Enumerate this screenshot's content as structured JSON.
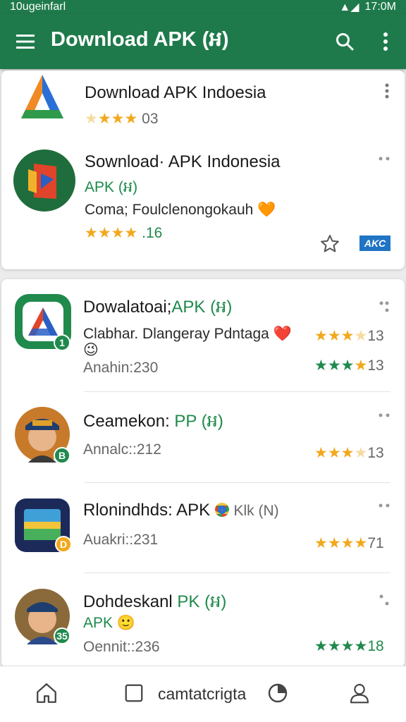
{
  "status_bar": {
    "left_text": "10ugeinfarl",
    "time": "17:0M"
  },
  "app_bar": {
    "title": "Download APK (អ)"
  },
  "featured": [
    {
      "title": "Download APK Indoesia",
      "rating_text": "03",
      "stars": 4
    },
    {
      "title": "Sownload· APK Indonesia",
      "tag": "APK (អ)",
      "description": "Coma; Foulclenongokauh 🧡",
      "rating_text": ".16",
      "stars": 4,
      "badge": "AKC"
    }
  ],
  "list": [
    {
      "title_prefix": "Dowalatoai;",
      "title_suffix": "APK (អ)",
      "description": "Clabhar. Dlangeray Pdntaga ❤️",
      "emoji": "😉",
      "meta": "Anahin:230",
      "rating1": "13",
      "rating2": "13",
      "badge": "1"
    },
    {
      "title_prefix": "Ceamekon:",
      "title_suffix": "PP (អ)",
      "meta": "Annalc::212",
      "rating1": "13",
      "badge": "B"
    },
    {
      "title_prefix": "Rlonindhds: APK",
      "title_suffix": "Klk (N)",
      "meta": "Auakri::231",
      "rating1": "71",
      "badge": "D"
    },
    {
      "title_prefix": "Dohdeskanl",
      "title_suffix": "PK (អ)",
      "tag": "APK 🙂",
      "meta": "Oennit::236",
      "rating1": "18",
      "badge": "35"
    }
  ],
  "bottom_nav": {
    "label": "camtatcrigta"
  },
  "colors": {
    "primary": "#1f7a4b",
    "accent_green": "#1f8a4c",
    "star": "#f2a81d"
  }
}
